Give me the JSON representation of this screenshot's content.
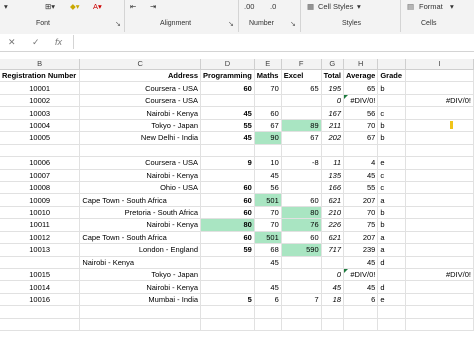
{
  "ribbon": {
    "font_label": "Font",
    "alignment_label": "Alignment",
    "number_label": "Number",
    "styles_label": "Styles",
    "cells_label": "Cells",
    "cell_styles_btn": "Cell Styles",
    "format_btn": "Format"
  },
  "formula_bar": {
    "cancel": "✕",
    "enter": "✓",
    "fx": "fx",
    "value": ""
  },
  "columns": [
    "B",
    "C",
    "D",
    "E",
    "F",
    "G",
    "H",
    "I"
  ],
  "headers": [
    "Registration Number",
    "Address",
    "Programming",
    "Maths",
    "Excel",
    "Total",
    "Average",
    "Grade"
  ],
  "rows": [
    {
      "reg": "10001",
      "addr": "Coursera - USA",
      "prog": "60",
      "maths": "70",
      "excel": "65",
      "total": "195",
      "avg": "65",
      "grade": "b",
      "extra": ""
    },
    {
      "reg": "10002",
      "addr": "Coursera - USA",
      "prog": "",
      "maths": "",
      "excel": "",
      "total": "0",
      "avg": "#DIV/0!",
      "grade": "",
      "extra": "#DIV/0!"
    },
    {
      "reg": "10003",
      "addr": "Nairobi - Kenya",
      "prog": "45",
      "maths": "60",
      "excel": "",
      "total": "167",
      "avg": "56",
      "grade": "c",
      "extra": ""
    },
    {
      "reg": "10004",
      "addr": "Tokyo - Japan",
      "prog": "55",
      "maths": "67",
      "excel": "89",
      "total": "211",
      "avg": "70",
      "grade": "b",
      "extra": ""
    },
    {
      "reg": "10005",
      "addr": "New Delhi - India",
      "prog": "45",
      "maths": "90",
      "excel": "67",
      "total": "202",
      "avg": "67",
      "grade": "b",
      "extra": ""
    },
    {
      "reg": "",
      "addr": "",
      "prog": "",
      "maths": "",
      "excel": "",
      "total": "",
      "avg": "",
      "grade": "",
      "extra": ""
    },
    {
      "reg": "10006",
      "addr": "Coursera - USA",
      "prog": "9",
      "maths": "10",
      "excel": "-8",
      "total": "11",
      "avg": "4",
      "grade": "e",
      "extra": ""
    },
    {
      "reg": "10007",
      "addr": "Nairobi - Kenya",
      "prog": "",
      "maths": "45",
      "excel": "",
      "total": "135",
      "avg": "45",
      "grade": "c",
      "extra": ""
    },
    {
      "reg": "10008",
      "addr": "Ohio - USA",
      "prog": "60",
      "maths": "56",
      "excel": "",
      "total": "166",
      "avg": "55",
      "grade": "c",
      "extra": ""
    },
    {
      "reg": "10009",
      "addr": "Cape Town - South Africa",
      "prog": "60",
      "maths": "501",
      "excel": "60",
      "total": "621",
      "avg": "207",
      "grade": "a",
      "extra": ""
    },
    {
      "reg": "10010",
      "addr": "Pretoria - South Africa",
      "prog": "60",
      "maths": "70",
      "excel": "80",
      "total": "210",
      "avg": "70",
      "grade": "b",
      "extra": ""
    },
    {
      "reg": "10011",
      "addr": "Nairobi - Kenya",
      "prog": "80",
      "maths": "70",
      "excel": "76",
      "total": "226",
      "avg": "75",
      "grade": "b",
      "extra": ""
    },
    {
      "reg": "10012",
      "addr": "Cape Town - South Africa",
      "prog": "60",
      "maths": "501",
      "excel": "60",
      "total": "621",
      "avg": "207",
      "grade": "a",
      "extra": ""
    },
    {
      "reg": "10013",
      "addr": "London - England",
      "prog": "59",
      "maths": "68",
      "excel": "590",
      "total": "717",
      "avg": "239",
      "grade": "a",
      "extra": ""
    },
    {
      "reg": "",
      "addr": "Nairobi - Kenya",
      "prog": "",
      "maths": "45",
      "excel": "",
      "total": "",
      "avg": "45",
      "grade": "d",
      "extra": ""
    },
    {
      "reg": "10015",
      "addr": "Tokyo - Japan",
      "prog": "",
      "maths": "",
      "excel": "",
      "total": "0",
      "avg": "#DIV/0!",
      "grade": "",
      "extra": "#DIV/0!"
    },
    {
      "reg": "10014",
      "addr": "Nairobi - Kenya",
      "prog": "",
      "maths": "45",
      "excel": "",
      "total": "45",
      "avg": "45",
      "grade": "d",
      "extra": ""
    },
    {
      "reg": "10016",
      "addr": "Mumbai - India",
      "prog": "5",
      "maths": "6",
      "excel": "7",
      "total": "18",
      "avg": "6",
      "grade": "e",
      "extra": ""
    },
    {
      "reg": "",
      "addr": "",
      "prog": "",
      "maths": "",
      "excel": "",
      "total": "",
      "avg": "",
      "grade": "",
      "extra": ""
    },
    {
      "reg": "",
      "addr": "",
      "prog": "",
      "maths": "",
      "excel": "",
      "total": "",
      "avg": "",
      "grade": "",
      "extra": ""
    }
  ]
}
